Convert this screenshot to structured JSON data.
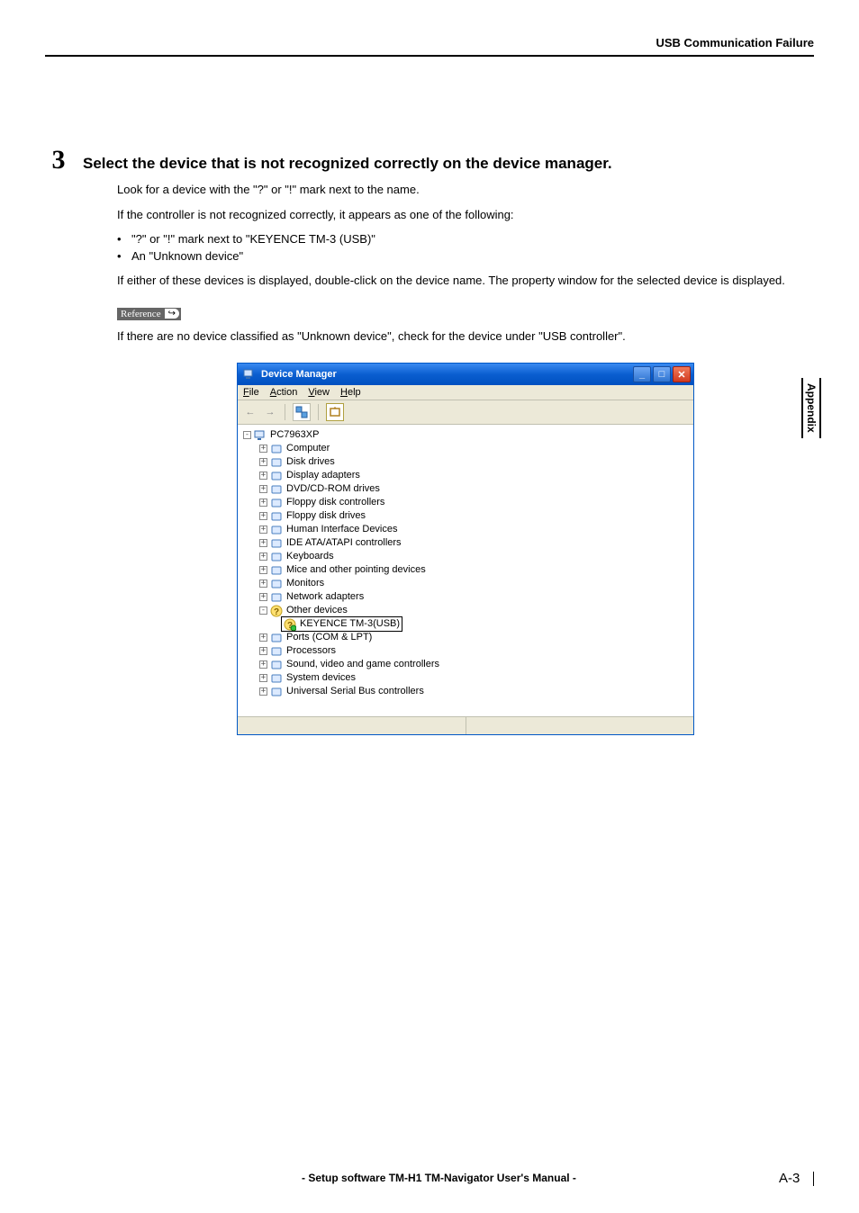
{
  "header": {
    "title": "USB Communication Failure"
  },
  "side_tab": "Appendix",
  "step": {
    "number": "3",
    "title": "Select the device that is not recognized correctly on the device manager.",
    "para1": "Look for a device with the \"?\" or \"!\" mark next to the name.",
    "para2": "If the controller is not recognized correctly, it appears as one of the following:",
    "bullets": [
      "\"?\" or \"!\" mark next to \"KEYENCE TM-3 (USB)\"",
      "An \"Unknown device\""
    ],
    "para3": "If either of these devices is displayed, double-click on the device name. The property window for the selected device is displayed.",
    "reference_label": "Reference",
    "para4": "If there are no device classified as \"Unknown device\", check for the device under \"USB controller\"."
  },
  "device_manager": {
    "title": "Device Manager",
    "menus": {
      "file": "File",
      "action": "Action",
      "view": "View",
      "help": "Help"
    },
    "root": "PC7963XP",
    "nodes": [
      "Computer",
      "Disk drives",
      "Display adapters",
      "DVD/CD-ROM drives",
      "Floppy disk controllers",
      "Floppy disk drives",
      "Human Interface Devices",
      "IDE ATA/ATAPI controllers",
      "Keyboards",
      "Mice and other pointing devices",
      "Monitors",
      "Network adapters"
    ],
    "other_devices_label": "Other devices",
    "highlighted_device": "KEYENCE TM-3(USB)",
    "nodes_after": [
      "Ports (COM & LPT)",
      "Processors",
      "Sound, video and game controllers",
      "System devices",
      "Universal Serial Bus controllers"
    ]
  },
  "footer": {
    "center": "- Setup software TM-H1 TM-Navigator User's Manual -",
    "page": "A-3"
  }
}
